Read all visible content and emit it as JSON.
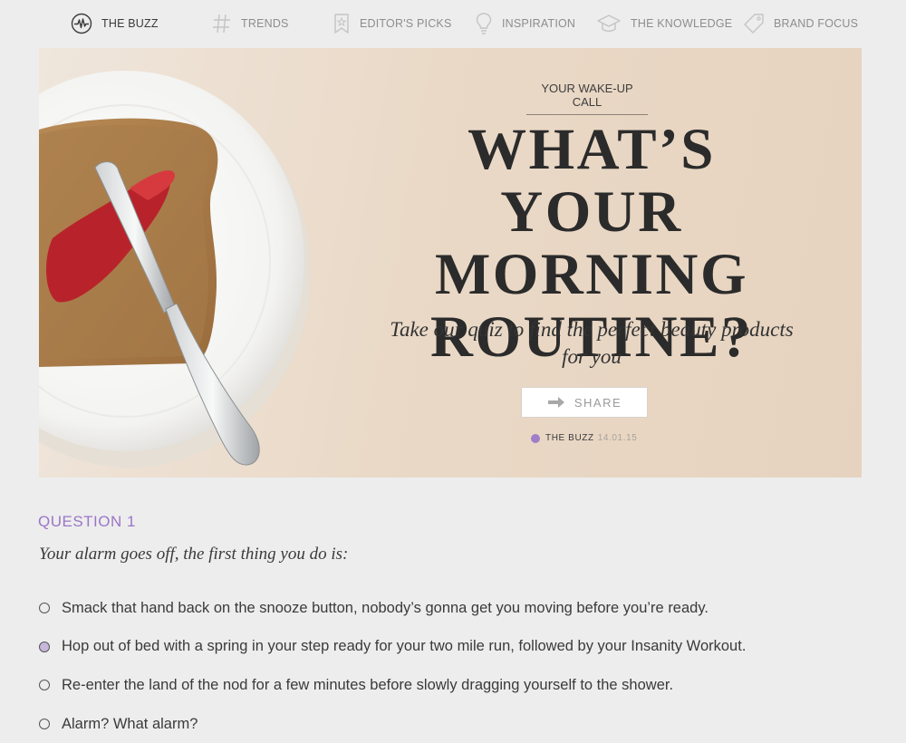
{
  "nav": {
    "items": [
      {
        "label": "THE BUZZ",
        "icon": "pulse-icon",
        "active": true
      },
      {
        "label": "TRENDS",
        "icon": "hashtag-icon",
        "active": false
      },
      {
        "label": "EDITOR'S PICKS",
        "icon": "bookmark-star-icon",
        "active": false
      },
      {
        "label": "INSPIRATION",
        "icon": "lightbulb-icon",
        "active": false
      },
      {
        "label": "THE KNOWLEDGE",
        "icon": "graduation-cap-icon",
        "active": false
      },
      {
        "label": "BRAND FOCUS",
        "icon": "tag-icon",
        "active": false
      }
    ]
  },
  "hero": {
    "kicker": "YOUR WAKE-UP CALL",
    "headline": "WHAT’S YOUR MORNING ROUTINE?",
    "subhead": "Take our quiz to find the perfect beauty products for you",
    "share_label": "SHARE",
    "category": "THE BUZZ",
    "date": "14.01.15",
    "image": "toast with jam and butter knife on white plate"
  },
  "question": {
    "number": "QUESTION 1",
    "text": "Your alarm goes off, the first thing you do is:",
    "options": [
      {
        "label": "Smack that hand back on the snooze button, nobody’s gonna get you moving before you’re ready.",
        "selected": false
      },
      {
        "label": "Hop out of bed with a spring in your step ready for your two mile run, followed by your Insanity Workout.",
        "selected": true
      },
      {
        "label": "Re-enter the land of the nod for a few minutes before slowly dragging yourself to the shower.",
        "selected": false
      },
      {
        "label": "Alarm? What alarm?",
        "selected": false
      }
    ]
  },
  "colors": {
    "accent": "#9a76c7",
    "background": "#ededed",
    "hero_bg": "#e9d8c6"
  }
}
